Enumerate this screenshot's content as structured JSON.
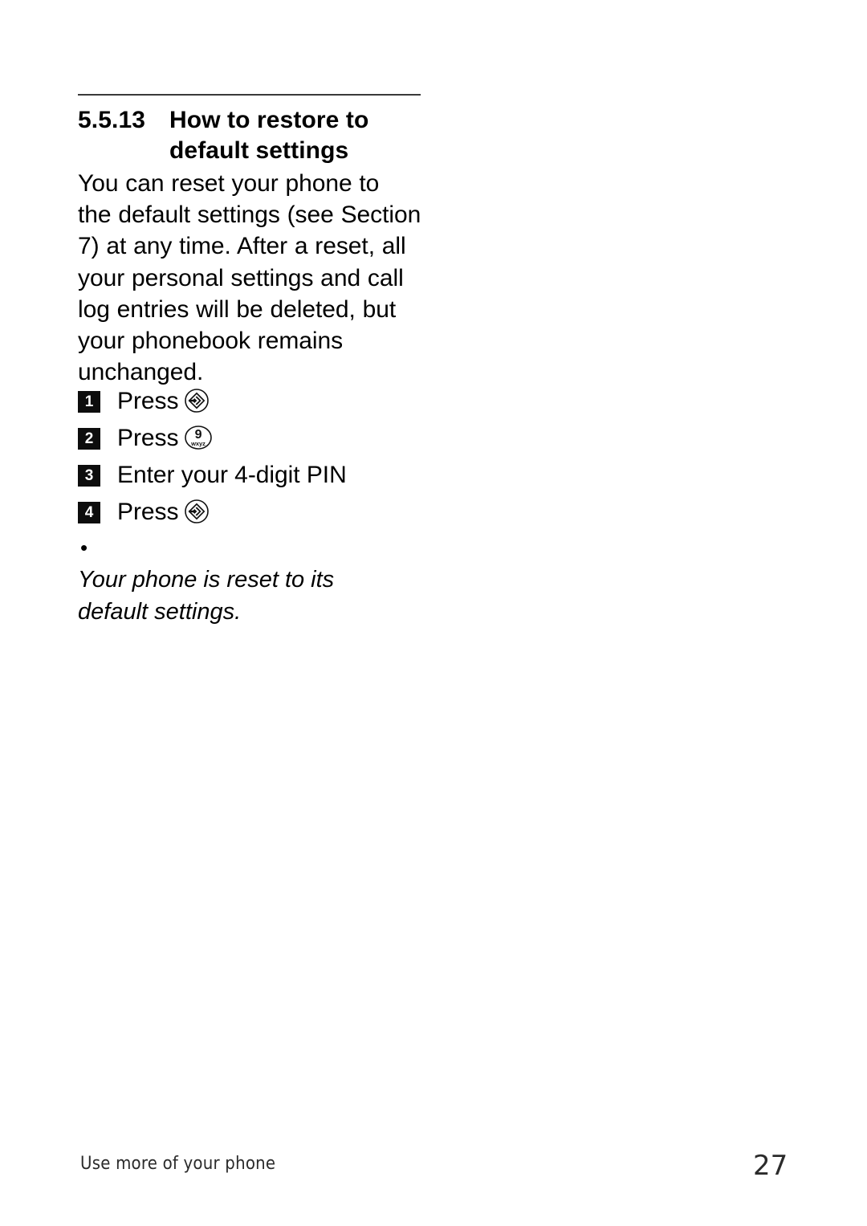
{
  "document": {
    "heading": {
      "number": "5.5.13",
      "title_line_1": "How to restore to",
      "title_line_2": "default settings"
    },
    "body_paragraph": {
      "full_text": "You can reset your phone to the default settings (see Section 7) at any time. After a reset, all your personal settings and call log entries will be deleted, but your phonebook remains unchanged.",
      "lines": [
        "You can reset your phone to",
        "the default settings (see Section",
        "7) at any time. After a reset, all",
        "your personal settings and call",
        "log entries will be deleted, but",
        "your phonebook remains",
        "unchanged."
      ]
    },
    "steps": [
      {
        "number": "1",
        "text": "Press",
        "icon": "menu-key-icon",
        "icon_label": ""
      },
      {
        "number": "2",
        "text": "Press",
        "icon": "keypad-key-9-icon",
        "icon_label": "9",
        "icon_sublabel": "wxyz"
      },
      {
        "number": "3",
        "text": "Enter your 4-digit PIN",
        "icon": "",
        "icon_label": ""
      },
      {
        "number": "4",
        "text": "Press",
        "icon": "menu-key-icon",
        "icon_label": ""
      }
    ],
    "note": {
      "bullet": "•",
      "lines": [
        "Your phone is reset to its",
        "default settings."
      ],
      "full_text": "Your phone is reset to its default settings."
    },
    "footer": {
      "section_label": "Use more of your phone",
      "page_number": "27"
    },
    "colors": {
      "text": "#000000",
      "rule": "#3a3a3a",
      "step_box_background": "#0d0d0d",
      "step_box_text": "#ffffff",
      "footer_text": "#2b2b2b",
      "page_background": "#ffffff"
    }
  }
}
